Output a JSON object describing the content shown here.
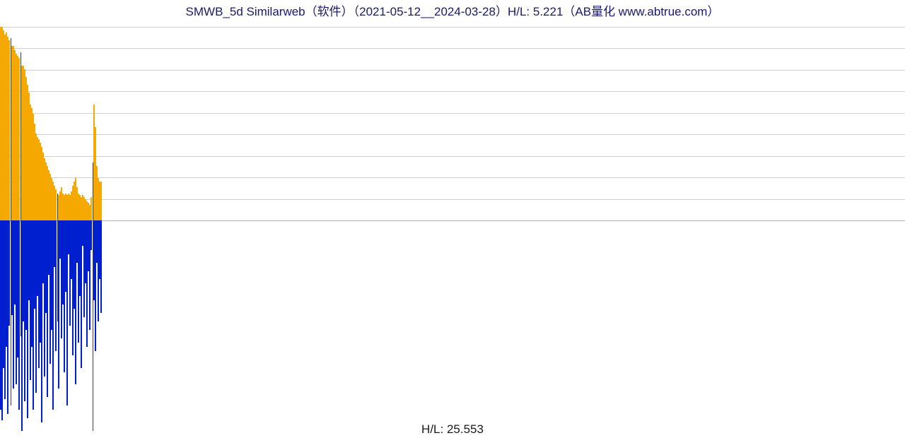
{
  "title": "SMWB_5d Similarweb（软件）（2021-05-12__2024-03-28）H/L: 5.221（AB量化  www.abtrue.com）",
  "footer": "H/L: 25.553",
  "chart_data": {
    "type": "bar",
    "title": "SMWB_5d Similarweb（软件）（2021-05-12__2024-03-28）H/L: 5.221",
    "xlabel": "",
    "ylabel": "",
    "date_range": [
      "2021-05-12",
      "2024-03-28"
    ],
    "upper": {
      "hl_ratio": 5.221,
      "baseline": 0,
      "grid_count": 9,
      "values_pct": [
        100,
        100,
        98,
        96,
        97,
        95,
        93,
        94,
        90,
        90,
        88,
        86,
        85,
        84,
        87,
        80,
        80,
        78,
        74,
        70,
        66,
        60,
        58,
        55,
        50,
        45,
        43,
        42,
        40,
        38,
        35,
        32,
        30,
        28,
        26,
        24,
        22,
        20,
        18,
        16,
        14,
        13,
        15,
        17,
        14,
        13,
        14,
        13,
        14,
        13,
        15,
        18,
        20,
        22,
        17,
        14,
        13,
        12,
        13,
        12,
        11,
        10,
        9,
        8,
        12,
        30,
        60,
        48,
        28,
        22,
        20,
        20
      ],
      "red_indices": [
        7,
        14,
        40,
        65
      ]
    },
    "lower": {
      "hl_ratio": 25.553,
      "baseline": 0,
      "values_pct": [
        90,
        95,
        70,
        85,
        60,
        92,
        50,
        88,
        45,
        80,
        40,
        78,
        65,
        90,
        55,
        100,
        48,
        86,
        52,
        94,
        38,
        76,
        60,
        90,
        42,
        82,
        36,
        70,
        58,
        96,
        30,
        74,
        44,
        84,
        26,
        68,
        52,
        90,
        22,
        62,
        48,
        80,
        18,
        56,
        40,
        72,
        34,
        88,
        16,
        50,
        28,
        64,
        42,
        78,
        20,
        58,
        36,
        70,
        12,
        46,
        30,
        60,
        24,
        52,
        14,
        100,
        38,
        62,
        20,
        48,
        28,
        44
      ],
      "red_indices": [
        7,
        14,
        40,
        65
      ]
    }
  }
}
